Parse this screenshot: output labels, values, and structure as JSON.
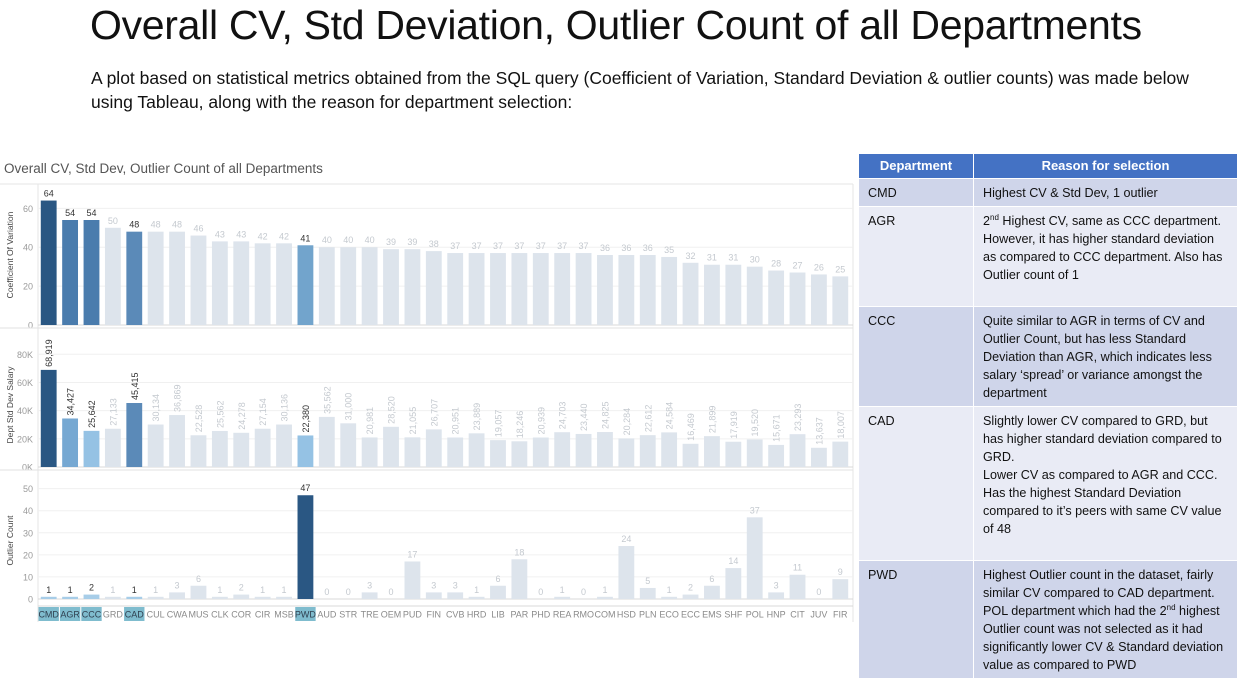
{
  "slide": {
    "title": "Overall CV, Std Deviation, Outlier Count of all Departments",
    "intro": "A plot based on statistical metrics obtained from the SQL query (Coefficient of Variation, Standard Deviation & outlier counts) was made below using Tableau, along with the reason for department selection:"
  },
  "table": {
    "headers": [
      "Department",
      "Reason for selection"
    ],
    "rows": [
      {
        "dept": "CMD",
        "reason_html": "Highest CV &amp; Std Dev, 1 outlier"
      },
      {
        "dept": "AGR",
        "reason_html": "2<sup>nd</sup> Highest CV, same as CCC department. However, it has higher standard deviation as compared to CCC department. Also has Outlier count of 1<br>&nbsp;"
      },
      {
        "dept": "CCC",
        "reason_html": "Quite similar to AGR in terms of CV and Outlier Count, but has less Standard Deviation than AGR, which indicates less salary ‘spread’ or variance amongst the department"
      },
      {
        "dept": "CAD",
        "reason_html": "Slightly lower CV compared to GRD, but has higher standard deviation compared to GRD.<br>Lower CV as compared to AGR and CCC. Has the highest Standard Deviation compared to it’s peers with same CV value of 48<br>&nbsp;"
      },
      {
        "dept": "PWD",
        "reason_html": "Highest Outlier count in the dataset, fairly similar CV compared to CAD department. POL department which had the 2<sup>nd</sup> highest Outlier count was not selected as it had significantly lower CV &amp; Standard deviation value as compared to PWD"
      }
    ]
  },
  "chart_data": {
    "type": "bar",
    "title": "Overall CV, Std Dev, Outlier Count of all Departments",
    "categories": [
      "CMD",
      "AGR",
      "CCC",
      "GRD",
      "CAD",
      "CUL",
      "CWA",
      "MUS",
      "CLK",
      "COR",
      "CIR",
      "MSB",
      "PWD",
      "AUD",
      "STR",
      "TRE",
      "OEM",
      "PUD",
      "FIN",
      "CVB",
      "HRD",
      "LIB",
      "PAR",
      "PHD",
      "REA",
      "RMO",
      "COM",
      "HSD",
      "PLN",
      "ECO",
      "ECC",
      "EMS",
      "SHF",
      "POL",
      "HNP",
      "CIT",
      "JUV",
      "FIR"
    ],
    "selected": [
      "CMD",
      "AGR",
      "CCC",
      "CAD",
      "PWD"
    ],
    "panels": [
      {
        "name": "Coefficient Of Variation",
        "ylabel": "Coefficient Of Variation",
        "ylim": [
          0,
          72
        ],
        "ticks": [
          0,
          20,
          40,
          60
        ],
        "tick_labels": [
          "0",
          "20",
          "40",
          "60"
        ],
        "label_orientation": "horizontal",
        "values": [
          64,
          54,
          54,
          50,
          48,
          48,
          48,
          46,
          43,
          43,
          42,
          42,
          41,
          40,
          40,
          40,
          39,
          39,
          38,
          37,
          37,
          37,
          37,
          37,
          37,
          37,
          36,
          36,
          36,
          35,
          32,
          31,
          31,
          30,
          28,
          27,
          26,
          25
        ],
        "labels": [
          "64",
          "54",
          "54",
          "50",
          "48",
          "48",
          "48",
          "46",
          "43",
          "43",
          "42",
          "42",
          "41",
          "40",
          "40",
          "40",
          "39",
          "39",
          "38",
          "37",
          "37",
          "37",
          "37",
          "37",
          "37",
          "37",
          "36",
          "36",
          "36",
          "35",
          "32",
          "31",
          "31",
          "30",
          "28",
          "27",
          "26",
          "25"
        ],
        "highlight_colors": {
          "CMD": "#2a5783",
          "AGR": "#4a7cad",
          "CCC": "#4a7cad",
          "CAD": "#5b8ab8",
          "PWD": "#72a4cc"
        }
      },
      {
        "name": "Dept Std Dev Salary",
        "ylabel": "Dept Std Dev Salary",
        "ylim": [
          0,
          88000
        ],
        "ticks": [
          0,
          20000,
          40000,
          60000,
          80000
        ],
        "tick_labels": [
          "0K",
          "20K",
          "40K",
          "60K",
          "80K"
        ],
        "label_orientation": "vertical",
        "values": [
          68919,
          34427,
          25642,
          27133,
          45415,
          30134,
          36869,
          22528,
          25562,
          24278,
          27154,
          30136,
          22380,
          35562,
          31000,
          20981,
          28520,
          21055,
          26707,
          20951,
          23889,
          19057,
          18246,
          20939,
          24703,
          23440,
          24825,
          20284,
          22612,
          24584,
          16469,
          21899,
          17919,
          19520,
          15671,
          23293,
          13637,
          18007
        ],
        "labels": [
          "68,919",
          "34,427",
          "25,642",
          "27,133",
          "45,415",
          "30,134",
          "36,869",
          "22,528",
          "25,562",
          "24,278",
          "27,154",
          "30,136",
          "22,380",
          "35,562",
          "31,000",
          "20,981",
          "28,520",
          "21,055",
          "26,707",
          "20,951",
          "23,889",
          "19,057",
          "18,246",
          "20,939",
          "24,703",
          "23,440",
          "24,825",
          "20,284",
          "22,612",
          "24,584",
          "16,469",
          "21,899",
          "17,919",
          "19,520",
          "15,671",
          "23,293",
          "13,637",
          "18,007"
        ],
        "highlight_colors": {
          "CMD": "#2a5783",
          "AGR": "#76a8d2",
          "CCC": "#95c2e4",
          "CAD": "#5b8ab8",
          "PWD": "#95c2e4"
        }
      },
      {
        "name": "Outlier Count",
        "ylabel": "Outlier Count",
        "ylim": [
          0,
          53
        ],
        "ticks": [
          0,
          10,
          20,
          30,
          40,
          50
        ],
        "tick_labels": [
          "0",
          "10",
          "20",
          "30",
          "40",
          "50"
        ],
        "label_orientation": "horizontal",
        "values": [
          1,
          1,
          2,
          1,
          1,
          1,
          3,
          6,
          1,
          2,
          1,
          1,
          47,
          0,
          0,
          3,
          0,
          17,
          3,
          3,
          1,
          6,
          18,
          0,
          1,
          0,
          1,
          24,
          5,
          1,
          2,
          6,
          14,
          37,
          3,
          11,
          0,
          9
        ],
        "labels": [
          "1",
          "1",
          "2",
          "1",
          "1",
          "1",
          "3",
          "6",
          "1",
          "2",
          "1",
          "1",
          "47",
          "0",
          "0",
          "3",
          "0",
          "17",
          "3",
          "3",
          "1",
          "6",
          "18",
          "0",
          "1",
          "0",
          "1",
          "24",
          "5",
          "1",
          "2",
          "6",
          "14",
          "37",
          "3",
          "11",
          "0",
          "9"
        ],
        "highlight_colors": {
          "CMD": "#a7cde8",
          "AGR": "#a7cde8",
          "CCC": "#a7cde8",
          "CAD": "#a7cde8",
          "PWD": "#2a5783"
        }
      }
    ],
    "colors": {
      "unselected_bar": "#dde4ec",
      "selected_label_bg": "#7fbcce",
      "label_dark": "#333333",
      "label_faded": "#c4c9cf",
      "axis_text": "#9a9a9a",
      "gridline": "#f0f0f0"
    },
    "grid": true,
    "legend": "none"
  }
}
